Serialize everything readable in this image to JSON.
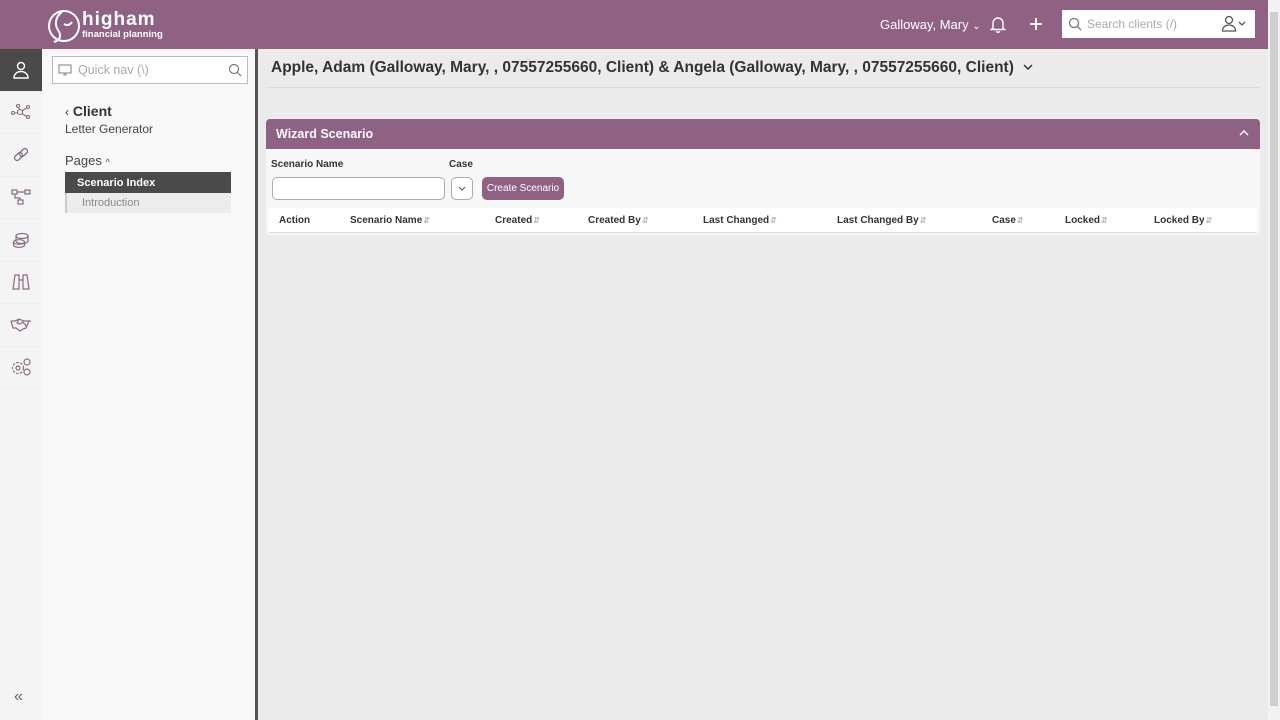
{
  "header": {
    "brand_line1": "higham",
    "brand_line2": "financial planning",
    "user_name": "Galloway, Mary",
    "search_placeholder": "Search clients (/)"
  },
  "rail": {
    "items": [
      "person-icon",
      "network-icon",
      "link-icon",
      "hierarchy-icon",
      "coins-icon",
      "binoculars-icon",
      "handshake-icon",
      "gears-icon"
    ],
    "collapse": "«"
  },
  "sidebar": {
    "quick_nav_placeholder": "Quick nav (\\)",
    "back_label": "Client",
    "subtitle": "Letter Generator",
    "pages_label": "Pages",
    "pages": [
      {
        "label": "Scenario Index",
        "active": true
      },
      {
        "label": "Introduction",
        "active": false
      }
    ]
  },
  "main": {
    "title": "Apple, Adam (Galloway, Mary, , 07557255660, Client) & Angela (Galloway, Mary, , 07557255660, Client)",
    "panel": {
      "title": "Wizard Scenario",
      "scenario_name_label": "Scenario Name",
      "case_label": "Case",
      "scenario_name_value": "",
      "create_button": "Create Scenario",
      "columns": [
        "Action",
        "Scenario Name",
        "Created",
        "Created By",
        "Last Changed",
        "Last Changed By",
        "Case",
        "Locked",
        "Locked By"
      ]
    }
  },
  "colors": {
    "brand": "#8f6284",
    "dark": "#4a4a4a"
  }
}
